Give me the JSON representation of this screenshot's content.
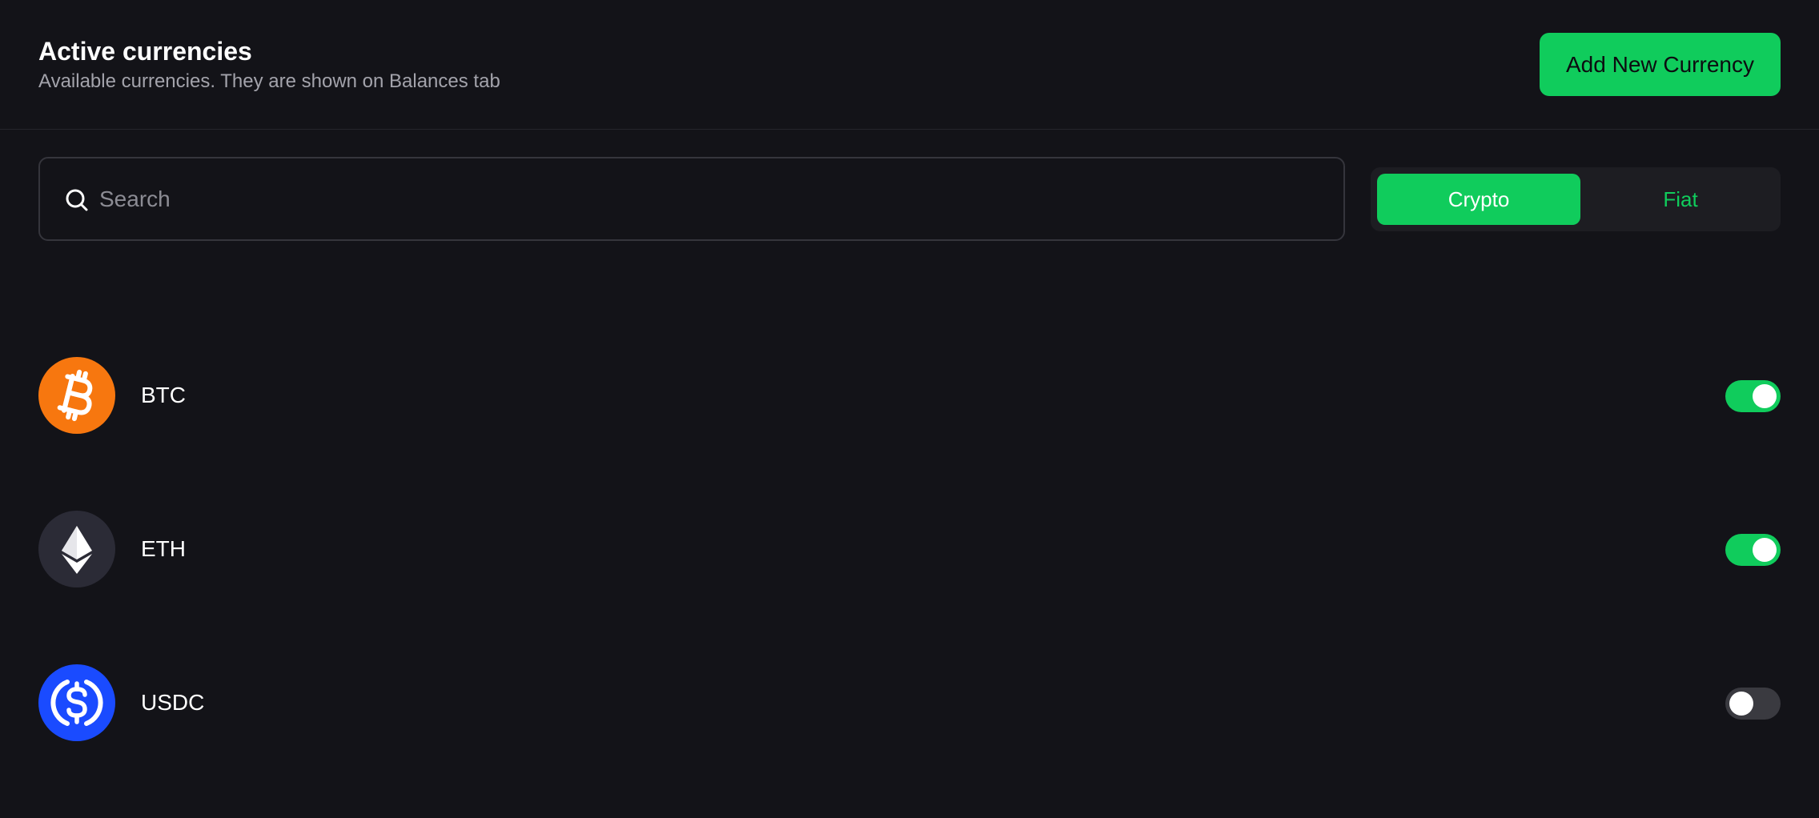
{
  "header": {
    "title": "Active currencies",
    "subtitle": "Available currencies. They are shown on Balances tab",
    "add_button_label": "Add New Currency"
  },
  "search": {
    "placeholder": "Search",
    "value": "",
    "icon": "search-icon"
  },
  "tabs": [
    {
      "label": "Crypto",
      "active": true
    },
    {
      "label": "Fiat",
      "active": false
    }
  ],
  "currencies": [
    {
      "symbol": "BTC",
      "icon": "bitcoin-icon",
      "color": "#f7770f",
      "enabled": true
    },
    {
      "symbol": "ETH",
      "icon": "ethereum-icon",
      "color": "#2b2b36",
      "enabled": true
    },
    {
      "symbol": "USDC",
      "icon": "usdc-icon",
      "color": "#1a4bff",
      "enabled": false
    }
  ],
  "colors": {
    "background": "#131318",
    "accent": "#10cc5c",
    "muted_text": "#a3a3ab",
    "border": "#35353c"
  }
}
